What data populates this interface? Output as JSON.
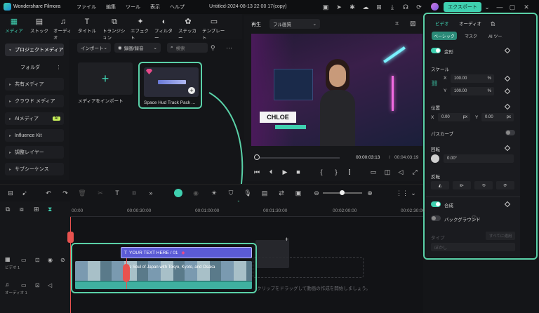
{
  "titlebar": {
    "app_name": "Wondershare Filmora",
    "menu": [
      "ファイル",
      "編集",
      "ツール",
      "表示",
      "ヘルプ"
    ],
    "project_title": "Untitled-2024-08-13 22 00 17(copy)",
    "export_label": "エクスポート"
  },
  "toolbar": {
    "tabs": [
      {
        "label": "メディア",
        "icon": "media-icon"
      },
      {
        "label": "ストック",
        "icon": "stock-icon"
      },
      {
        "label": "オーディオ",
        "icon": "audio-icon"
      },
      {
        "label": "タイトル",
        "icon": "title-icon"
      },
      {
        "label": "トランジション",
        "icon": "transition-icon"
      },
      {
        "label": "エフェクト",
        "icon": "effect-icon"
      },
      {
        "label": "フィルター",
        "icon": "filter-icon"
      },
      {
        "label": "ステッカー",
        "icon": "sticker-icon"
      },
      {
        "label": "テンプレート",
        "icon": "template-icon"
      }
    ]
  },
  "sidebar": {
    "items": [
      {
        "label": "プロジェクトメディア"
      },
      {
        "label": "フォルダ"
      },
      {
        "label": "共有メディア"
      },
      {
        "label": "クラウド メディア"
      },
      {
        "label": "AIメディア",
        "badge": "AI"
      },
      {
        "label": "Influence Kit"
      },
      {
        "label": "調整レイヤー"
      },
      {
        "label": "サブシーケンス"
      }
    ]
  },
  "media": {
    "import_label": "インポート",
    "record_label": "録画/録音",
    "search_placeholder": "検索",
    "import_tile_label": "メディアをインポート",
    "clip_label": "Space Hud Track Pack ..."
  },
  "player": {
    "play_label": "再生",
    "quality": "フル画質",
    "name_card": "CHLOE",
    "current_time": "00:00:03:13",
    "total_time": "00:04:03:19",
    "progress": 0.013
  },
  "timeline": {
    "ruler": [
      "00:00",
      "00:00:30:00",
      "00:01:00:00",
      "00:01:30:00",
      "00:02:00:00",
      "00:02:30:00"
    ],
    "title_clip": "YOUR TEXT HERE / 01",
    "video_clip": "The Soul of Japan with Tokyo, Kyoto, and Osaka",
    "drop_hint": "クリップをドラッグして動画の作成を開始しましょう。",
    "track_video_label": "ビデオ 1",
    "track_audio_label": "オーディオ 1"
  },
  "properties": {
    "tabs": [
      "ビデオ",
      "オーディオ",
      "色"
    ],
    "subtabs": [
      "ベーシック",
      "マスク",
      "AI ツール"
    ],
    "transform_label": "変形",
    "scale_label": "スケール",
    "scale_x": "100.00",
    "scale_y": "100.00",
    "percent": "%",
    "position_label": "位置",
    "pos_x": "0.00",
    "pos_y": "0.00",
    "px": "px",
    "x": "X",
    "y": "Y",
    "pathcurve_label": "パスカーブ",
    "rotate_label": "回転",
    "rotate_value": "0.00°",
    "flip_label": "反転",
    "composite_label": "合成",
    "background_label": "バックグラウンド",
    "type_label": "タイプ",
    "apply_all_label": "すべてに適用",
    "blur_label": "ぼかし"
  },
  "colors": {
    "accent": "#3fd0b0",
    "highlight": "#5ad1a8",
    "title_clip": "#5b5bd6",
    "playhead": "#e8524f"
  }
}
